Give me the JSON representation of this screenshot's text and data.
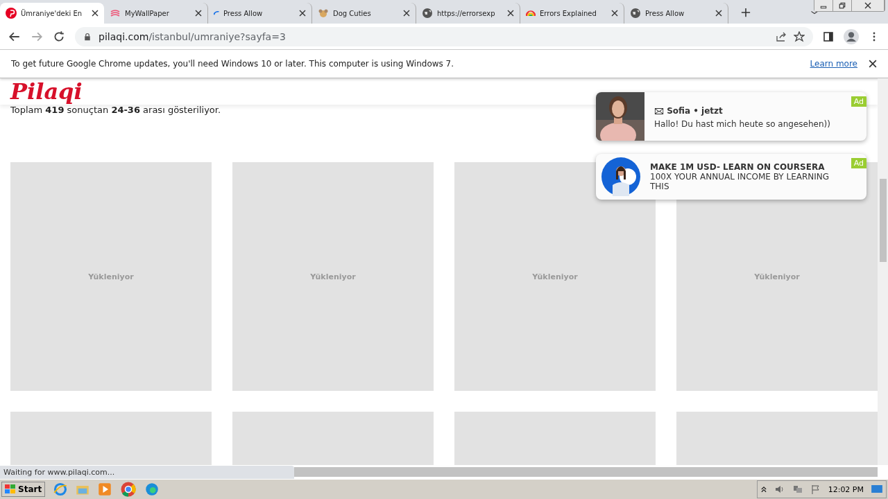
{
  "tabs": [
    {
      "title": "Ümraniye'deki En",
      "kind": "pin",
      "selected": true
    },
    {
      "title": "MyWallPaper",
      "kind": "wall",
      "selected": false
    },
    {
      "title": "Press Allow",
      "kind": "spinner",
      "selected": false
    },
    {
      "title": "Dog Cuties",
      "kind": "dog",
      "selected": false
    },
    {
      "title": "https://errorsexp",
      "kind": "globe",
      "selected": false
    },
    {
      "title": "Errors Explained",
      "kind": "rainbow",
      "selected": false
    },
    {
      "title": "Press Allow",
      "kind": "globe",
      "selected": false
    }
  ],
  "address": {
    "host": "pilaqi.com",
    "path": "/istanbul/umraniye?sayfa=3"
  },
  "infobar": {
    "message": "To get future Google Chrome updates, you'll need Windows 10 or later. This computer is using Windows 7.",
    "link": "Learn more"
  },
  "site": {
    "logo": "Pilaqi",
    "results": "Toplam **419** sonuçtan **24-36** arası gösteriliyor.",
    "cards": [
      {
        "kind": "loading",
        "label": "Yükleniyor"
      },
      {
        "kind": "loading",
        "label": "Yükleniyor"
      },
      {
        "kind": "loading",
        "label": "Yükleniyor"
      },
      {
        "kind": "loading",
        "label": "Yükleniyor"
      },
      {
        "kind": "blank"
      },
      {
        "kind": "blank"
      },
      {
        "kind": "blank"
      },
      {
        "kind": "blank"
      }
    ]
  },
  "ads": [
    {
      "title": "🖂 Sofia • jetzt",
      "text": "Hallo! Du hast mich heute so angesehen))",
      "badge": "Ad"
    },
    {
      "kind": "avatar",
      "title": "MAKE 1M USD- LEARN ON COURSERA",
      "text": "100X YOUR ANNUAL INCOME BY LEARNING THIS",
      "badge": "Ad"
    }
  ],
  "status": "Waiting for www.pilaqi.com...",
  "taskbar": {
    "start": "Start",
    "clock": "12:02 PM"
  }
}
